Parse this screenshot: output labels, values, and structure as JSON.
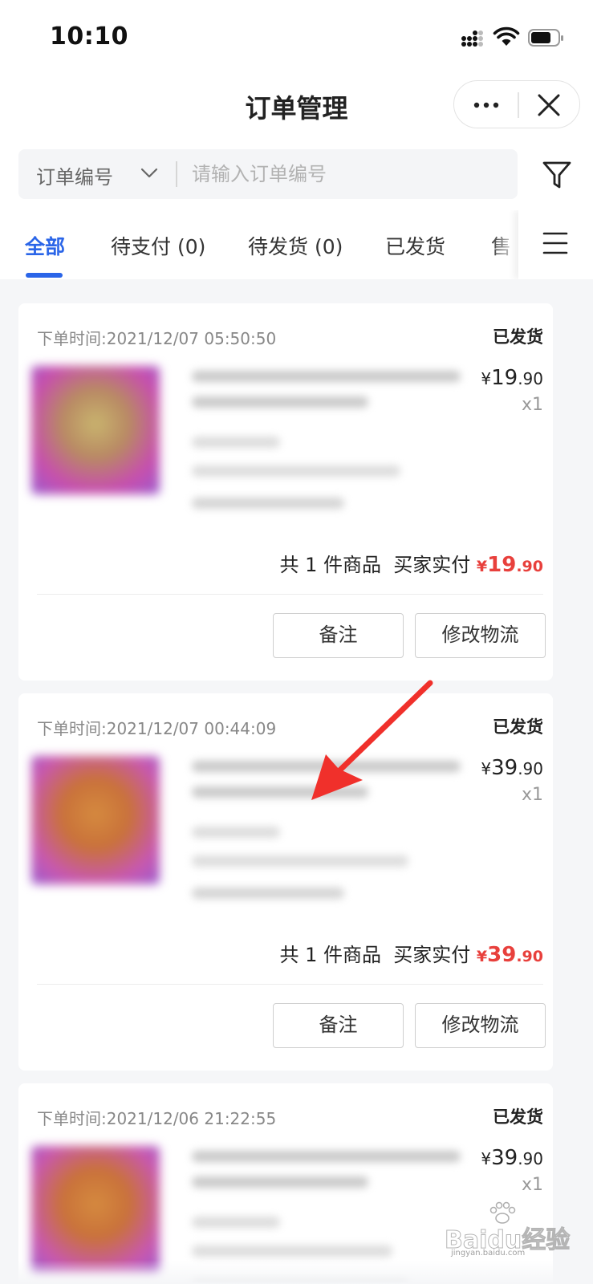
{
  "status_bar": {
    "time": "10:10"
  },
  "nav": {
    "title": "订单管理"
  },
  "search": {
    "type_label": "订单编号",
    "placeholder": "请输入订单编号"
  },
  "tabs": [
    {
      "label": "全部"
    },
    {
      "label": "待支付 (0)"
    },
    {
      "label": "待发货 (0)"
    },
    {
      "label": "已发货"
    },
    {
      "label": "售"
    }
  ],
  "orders": [
    {
      "time": "下单时间:2021/12/07 05:50:50",
      "status": "已发货",
      "price_currency": "¥",
      "price_int": "19",
      "price_dec": ".90",
      "qty": "x1",
      "summary_count": "共 1 件商品",
      "summary_paid_label": "买家实付",
      "paid_currency": "¥",
      "paid_int": "19",
      "paid_dec": ".90",
      "remark_button": "备注",
      "logistics_button": "修改物流"
    },
    {
      "time": "下单时间:2021/12/07 00:44:09",
      "status": "已发货",
      "price_currency": "¥",
      "price_int": "39",
      "price_dec": ".90",
      "qty": "x1",
      "summary_count": "共 1 件商品",
      "summary_paid_label": "买家实付",
      "paid_currency": "¥",
      "paid_int": "39",
      "paid_dec": ".90",
      "remark_button": "备注",
      "logistics_button": "修改物流"
    },
    {
      "time": "下单时间:2021/12/06 21:22:55",
      "status": "已发货",
      "price_currency": "¥",
      "price_int": "39",
      "price_dec": ".90",
      "qty": "x1"
    }
  ],
  "watermark": {
    "text": "Baidu经验",
    "url": "jingyan.baidu.com"
  },
  "colors": {
    "accent": "#2a65e8",
    "price_red": "#e8403c",
    "annotation_arrow": "#f0302b"
  },
  "icons": {
    "signal": "signal-icon",
    "wifi": "wifi-icon",
    "battery": "battery-icon",
    "more": "more-dots-icon",
    "close": "close-icon",
    "dropdown": "chevron-down-icon",
    "filter": "filter-funnel-icon",
    "menu": "menu-hamburger-icon",
    "arrow": "annotation-arrow-icon"
  }
}
